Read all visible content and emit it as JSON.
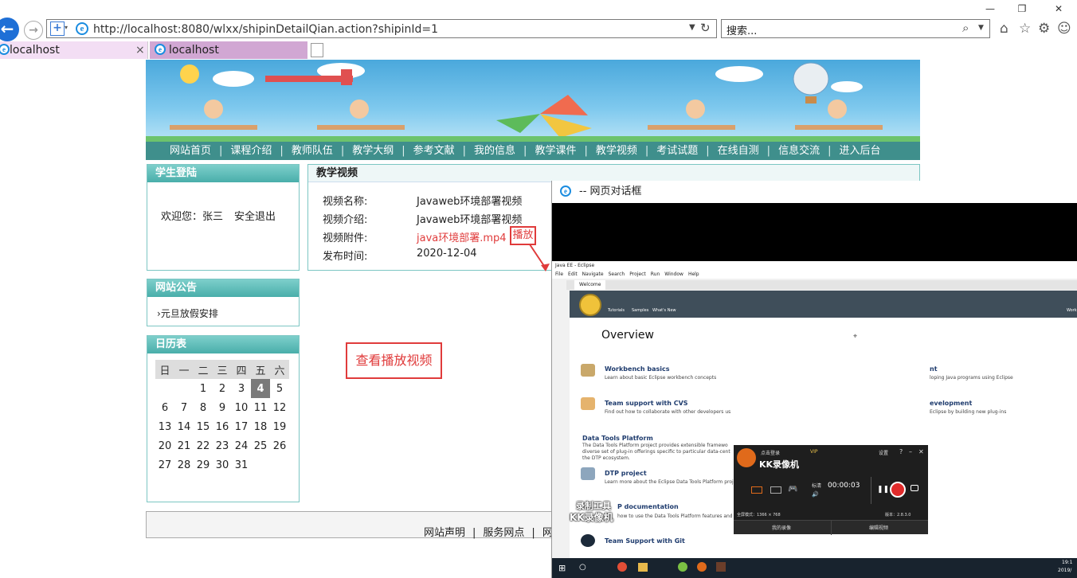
{
  "browser": {
    "address": "http://localhost:8080/wlxx/shipinDetailQian.action?shipinId=1",
    "search_placeholder": "搜索...",
    "tabs": [
      {
        "label": "localhost",
        "close": "×"
      },
      {
        "label": "localhost"
      }
    ]
  },
  "nav": {
    "items": [
      "网站首页",
      "课程介绍",
      "教师队伍",
      "教学大纲",
      "参考文献",
      "我的信息",
      "教学课件",
      "教学视频",
      "考试试题",
      "在线自测",
      "信息交流",
      "进入后台"
    ],
    "separator": "|"
  },
  "login": {
    "title": "学生登陆",
    "welcome": "欢迎您：张三",
    "logout": "安全退出"
  },
  "notice": {
    "title": "网站公告",
    "items": [
      "元旦放假安排"
    ]
  },
  "calendar": {
    "title": "日历表",
    "weekdays": [
      "日",
      "一",
      "二",
      "三",
      "四",
      "五",
      "六"
    ],
    "rows": [
      [
        "",
        "",
        "1",
        "2",
        "3",
        "4",
        "5"
      ],
      [
        "6",
        "7",
        "8",
        "9",
        "10",
        "11",
        "12"
      ],
      [
        "13",
        "14",
        "15",
        "16",
        "17",
        "18",
        "19"
      ],
      [
        "20",
        "21",
        "22",
        "23",
        "24",
        "25",
        "26"
      ],
      [
        "27",
        "28",
        "29",
        "30",
        "31",
        "",
        ""
      ]
    ],
    "today": "4"
  },
  "video": {
    "title": "教学视频",
    "name_label": "视频名称:",
    "name": "Javaweb环境部署视频",
    "intro_label": "视频介绍:",
    "intro": "Javaweb环境部署视频",
    "file_label": "视频附件:",
    "file": "java环境部署.mp4",
    "play": "播放",
    "date_label": "发布时间:",
    "date": "2020-12-04"
  },
  "annotation": "查看播放视频",
  "footer": {
    "links": [
      "网站声明",
      "服务网点",
      "网站"
    ],
    "separator": "|"
  },
  "dialog": {
    "title": "-- 网页对话框"
  },
  "eclipse": {
    "title": "Java EE - Eclipse",
    "menu": [
      "File",
      "Edit",
      "Navigate",
      "Search",
      "Project",
      "Run",
      "Window",
      "Help"
    ],
    "welcome_tab": "Welcome",
    "toolbar": [
      "Tutorials",
      "Samples",
      "What's New"
    ],
    "overview": "Overview",
    "right_edge": "Work",
    "items": [
      {
        "title": "Workbench basics",
        "desc": "Learn about basic Eclipse workbench concepts"
      },
      {
        "title": "Team support with CVS",
        "desc": "Find out how to collaborate with other developers us"
      },
      {
        "title": "Data Tools Platform",
        "desc": "The Data Tools Platform project provides extensible framewo"
      },
      {
        "title": "DTP project",
        "desc": "Learn more about the Eclipse Data Tools Platform project"
      },
      {
        "title": "P documentation",
        "desc": "how to use the Data Tools Platform features and tools"
      },
      {
        "title": "Team Support with Git",
        "desc": ""
      }
    ],
    "desc_extra": [
      "diverse set of plug-in offerings specific to particular data-cent",
      "the DTP ecosystem."
    ],
    "right_items": [
      {
        "title": "nt",
        "desc": "loping Java programs using Eclipse"
      },
      {
        "title": "evelopment",
        "desc": "Eclipse by building new plug-ins"
      }
    ],
    "watermark": [
      "录制工具",
      "KK录像机"
    ]
  },
  "kk": {
    "login": "点击登录",
    "vip": "VIP",
    "settings": "设置",
    "help": "?",
    "minimize": "–",
    "close": "✕",
    "brand": "KK录像机",
    "quality": "标清",
    "timer": "00:00:03",
    "mode": "全屏模式：1366 × 768",
    "version": "版本：2.8.3.0",
    "my_recordings": "我的录像",
    "edit_video": "编辑视频"
  },
  "taskbar": {
    "time": "19:1",
    "date": "2019/"
  },
  "colors": {
    "nav_bg": "#3f8f8c",
    "box_head": "#49aeaa",
    "red": "#e03b3b",
    "ie_blue": "#1a8ce0"
  }
}
